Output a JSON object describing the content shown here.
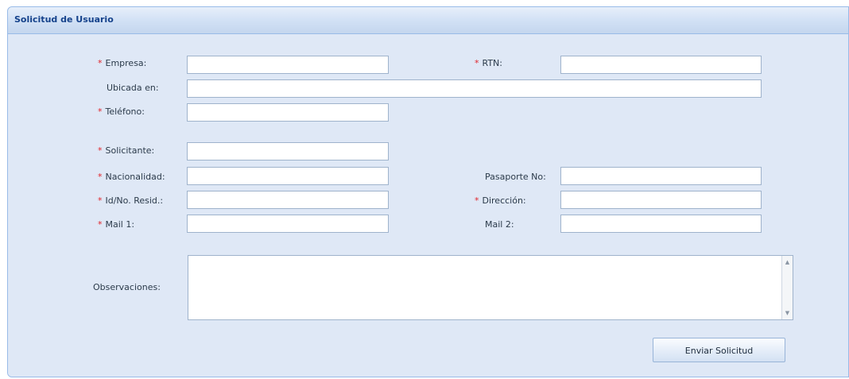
{
  "panel": {
    "title": "Solicitud de Usuario"
  },
  "form": {
    "required_marker": "*",
    "empresa": {
      "label": "Empresa:",
      "value": ""
    },
    "rtn": {
      "label": "RTN:",
      "value": ""
    },
    "ubicada_en": {
      "label": "Ubicada en:",
      "value": ""
    },
    "telefono": {
      "label": "Teléfono:",
      "value": ""
    },
    "solicitante": {
      "label": "Solicitante:",
      "value": ""
    },
    "nacionalidad": {
      "label": "Nacionalidad:",
      "value": ""
    },
    "pasaporte": {
      "label": "Pasaporte No:",
      "value": ""
    },
    "id_resid": {
      "label": "Id/No. Resid.:",
      "value": ""
    },
    "direccion": {
      "label": "Dirección:",
      "value": ""
    },
    "mail1": {
      "label": "Mail 1:",
      "value": ""
    },
    "mail2": {
      "label": "Mail 2:",
      "value": ""
    },
    "observaciones": {
      "label": "Observaciones:",
      "value": ""
    }
  },
  "actions": {
    "submit_label": "Enviar Solicitud"
  },
  "icons": {
    "scroll_up": "▲",
    "scroll_down": "▼"
  },
  "colors": {
    "required": "#e0252b",
    "panel_bg": "#dfe8f6",
    "title": "#15428b"
  }
}
